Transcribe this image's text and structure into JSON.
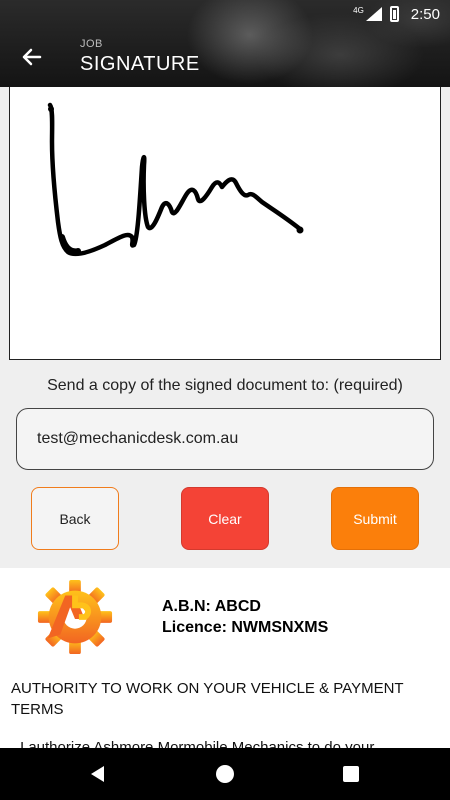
{
  "status_bar": {
    "network": "4G",
    "time": "2:50"
  },
  "header": {
    "subtitle": "JOB",
    "title": "SIGNATURE"
  },
  "form": {
    "send_copy_label": "Send a copy of the signed document to: (required)",
    "email_value": "test@mechanicdesk.com.au"
  },
  "buttons": {
    "back": "Back",
    "clear": "Clear",
    "submit": "Submit"
  },
  "document": {
    "abn": "A.B.N: ABCD",
    "licence": "Licence: NWMSNXMS",
    "authority_heading": "AUTHORITY TO WORK ON YOUR VEHICLE & PAYMENT TERMS",
    "authority_body": "I authorize Ashmore Mormobile Mechanics to do your"
  },
  "colors": {
    "accent_orange": "#fb7f0b",
    "clear_red": "#f44336",
    "logo_orange": "#f7931e"
  },
  "icons": {
    "back": "arrow-left-icon",
    "nav_back": "triangle-back-icon",
    "nav_home": "circle-home-icon",
    "nav_recents": "square-recents-icon"
  }
}
